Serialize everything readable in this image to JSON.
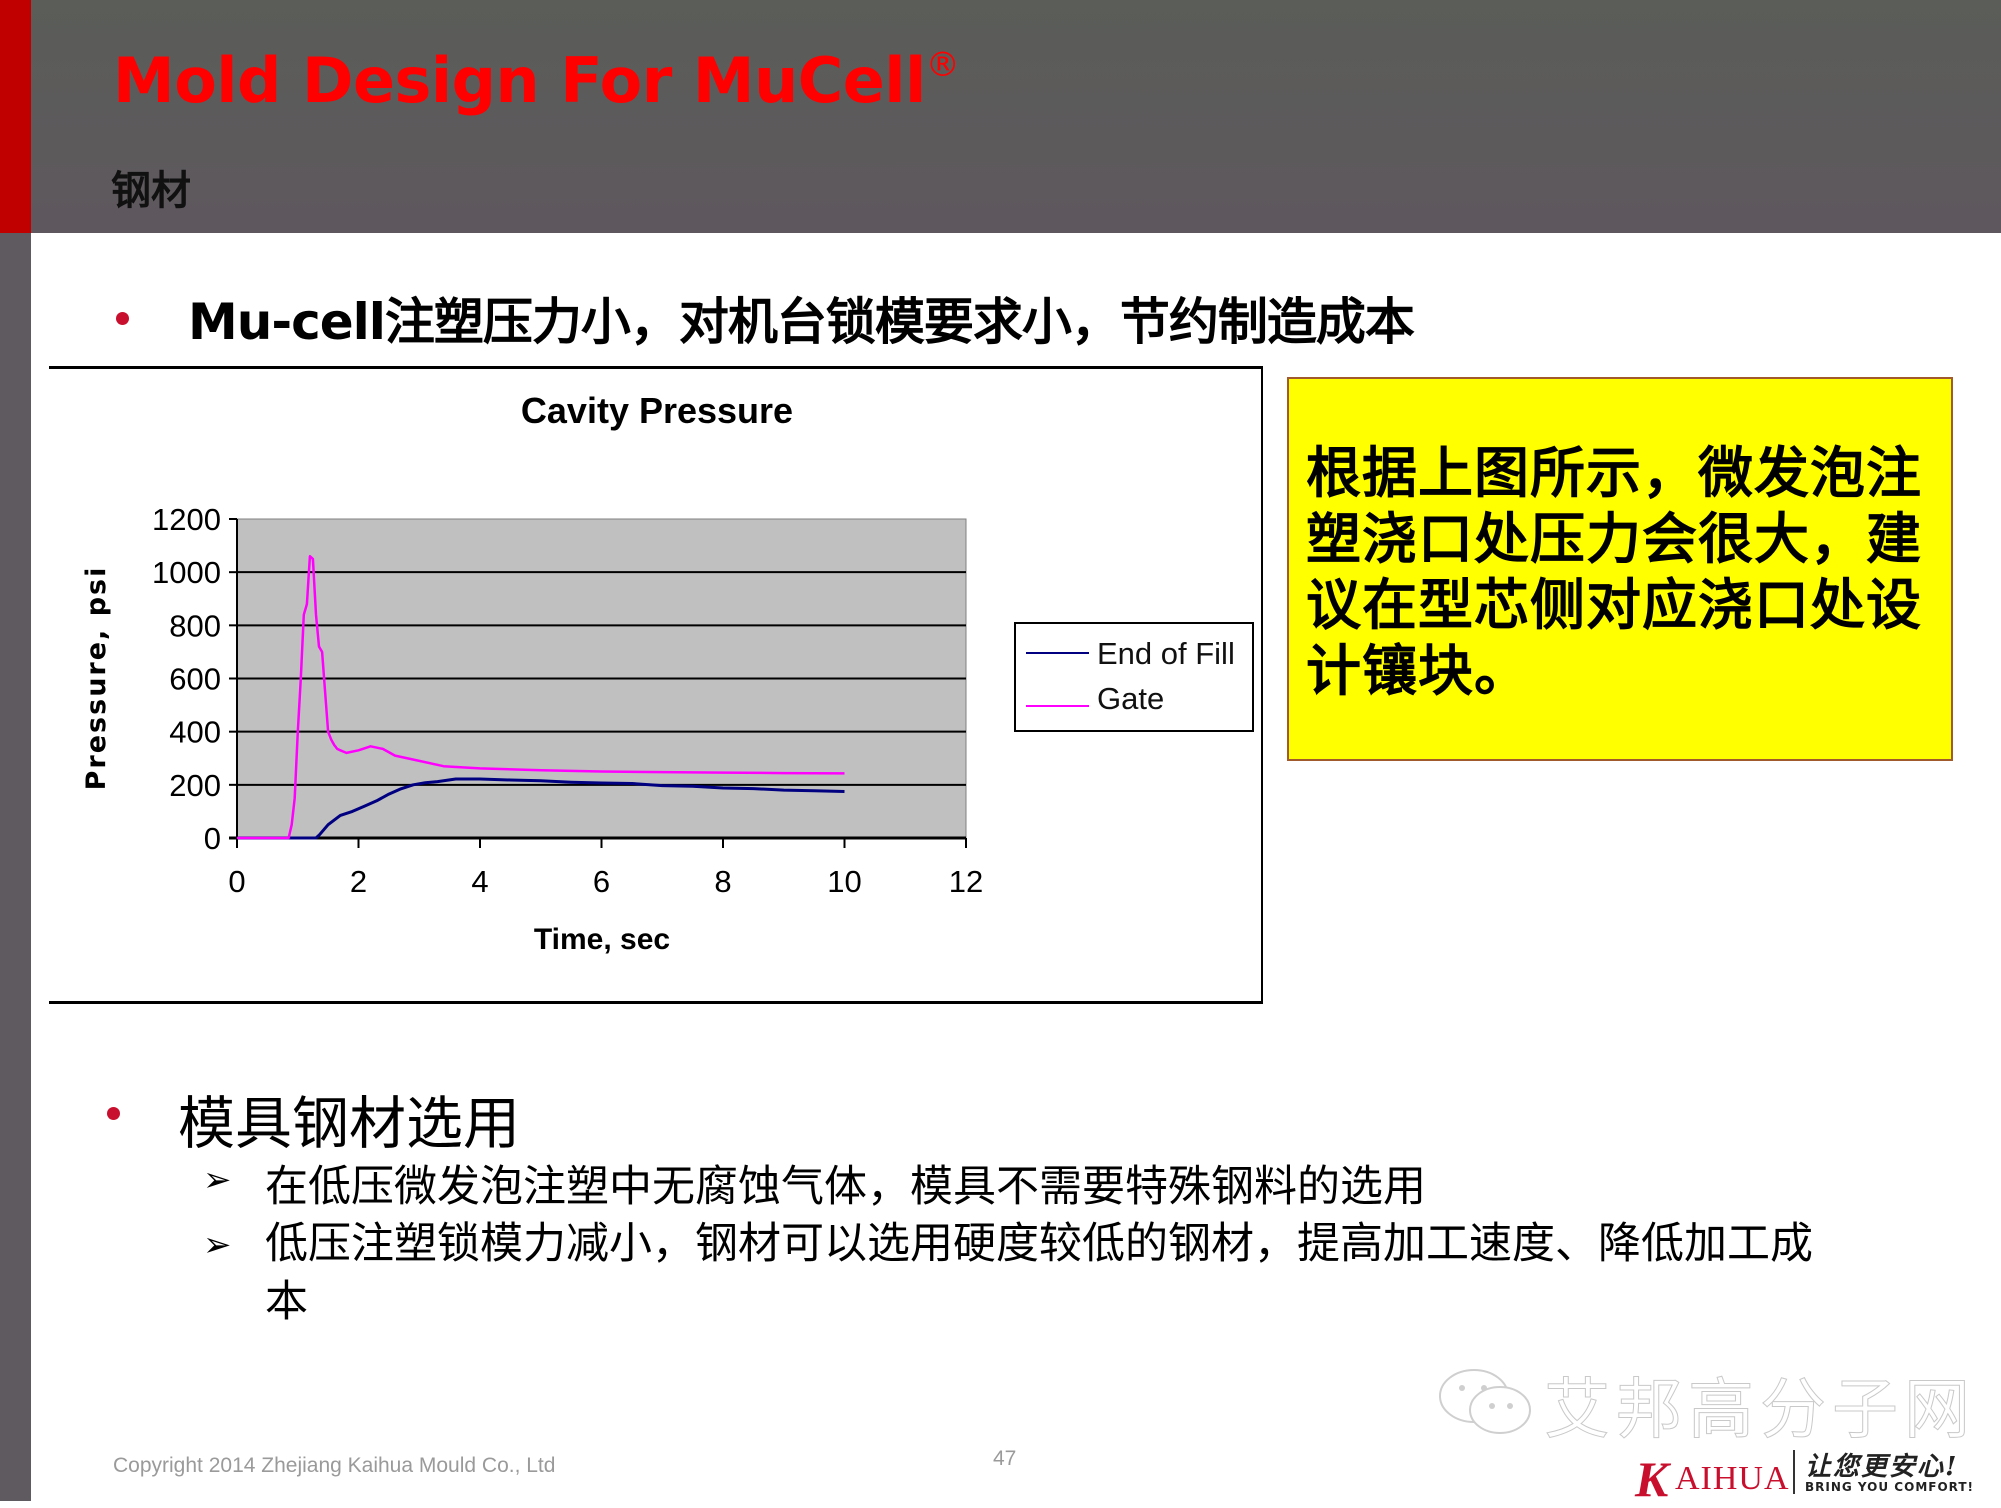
{
  "header": {
    "title": "Mold Design For MuCell",
    "title_mark": "®",
    "subtitle": "钢材",
    "accent_color": "#ff0000",
    "side_bar_color": "#c00000"
  },
  "bullet1": {
    "text": "Mu-cell注塑压力小，对机台锁模要求小，节约制造成本"
  },
  "callout": {
    "text": "根据上图所示，微发泡注塑浇口处压力会很大，建议在型芯侧对应浇口处设计镶块。",
    "background": "#ffff00"
  },
  "bullet2": {
    "text": "模具钢材选用",
    "sub_items": [
      {
        "icon": "arrow-bullet-icon",
        "text": "在低压微发泡注塑中无腐蚀气体，模具不需要特殊钢料的选用"
      },
      {
        "icon": "arrow-bullet-icon",
        "text": "低压注塑锁模力减小，钢材可以选用硬度较低的钢材，提高加工速度、降低加工成本"
      }
    ]
  },
  "footer": {
    "copyright": "Copyright 2014 Zhejiang Kaihua Mould Co., Ltd",
    "page_number": "47",
    "watermark": "艾邦高分子网",
    "logo_k": "K",
    "logo_rest": "AIHUA",
    "slogan_cn": "让您更安心!",
    "slogan_en": "BRING YOU COMFORT!"
  },
  "chart_data": {
    "type": "line",
    "title": "Cavity Pressure",
    "xlabel": "Time, sec",
    "ylabel": "Pressure, psi",
    "xlim": [
      0,
      12
    ],
    "ylim": [
      0,
      1200
    ],
    "x_ticks": [
      "0",
      "2",
      "4",
      "6",
      "8",
      "10",
      "12"
    ],
    "y_ticks": [
      "0",
      "200",
      "400",
      "600",
      "800",
      "1000",
      "1200"
    ],
    "grid": "horizontal",
    "plot_background": "#c0c0c0",
    "legend_position": "right",
    "series": [
      {
        "name": "End of Fill",
        "color": "#000080",
        "x": [
          0,
          1.3,
          1.35,
          1.5,
          1.7,
          1.9,
          2.1,
          2.3,
          2.5,
          2.7,
          2.9,
          3.1,
          3.3,
          3.6,
          4.0,
          4.5,
          5.0,
          5.5,
          6.0,
          6.5,
          7.0,
          7.5,
          8.0,
          8.5,
          9.0,
          9.5,
          10.0
        ],
        "y": [
          0,
          0,
          10,
          50,
          85,
          100,
          120,
          140,
          165,
          185,
          200,
          208,
          212,
          222,
          222,
          218,
          215,
          210,
          207,
          205,
          197,
          195,
          188,
          186,
          180,
          178,
          175
        ]
      },
      {
        "name": "Gate",
        "color": "#ff00ff",
        "x": [
          0,
          0.85,
          0.9,
          0.95,
          1.0,
          1.05,
          1.1,
          1.15,
          1.2,
          1.25,
          1.3,
          1.35,
          1.4,
          1.45,
          1.5,
          1.55,
          1.6,
          1.65,
          1.7,
          1.8,
          2.0,
          2.2,
          2.4,
          2.6,
          3.0,
          3.4,
          4.0,
          5.0,
          6.0,
          7.0,
          8.0,
          9.0,
          10.0
        ],
        "y": [
          0,
          0,
          50,
          150,
          400,
          600,
          840,
          880,
          1060,
          1050,
          840,
          720,
          700,
          550,
          400,
          370,
          350,
          335,
          330,
          320,
          330,
          345,
          335,
          310,
          290,
          270,
          262,
          255,
          250,
          248,
          246,
          244,
          243
        ]
      }
    ]
  }
}
